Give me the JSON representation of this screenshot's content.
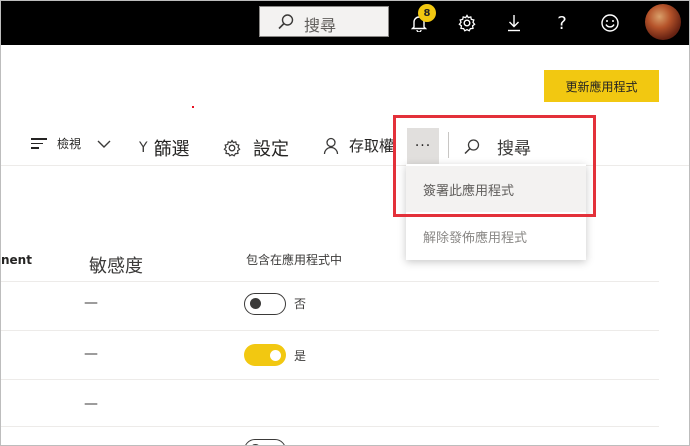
{
  "header": {
    "search_placeholder": "搜尋",
    "notification_count": "8",
    "icons": [
      "bell-icon",
      "gear-icon",
      "download-icon",
      "help-icon",
      "smiley-icon",
      "avatar"
    ]
  },
  "actions": {
    "update_app_label": "更新應用程式"
  },
  "toolbar": {
    "view_label": "檢視",
    "filter_label": "篩選",
    "settings_label": "設定",
    "access_label": "存取權",
    "more_label": "···",
    "search_label": "搜尋"
  },
  "more_menu": {
    "items": [
      {
        "label": "簽署此應用程式"
      },
      {
        "label": "解除發佈應用程式"
      }
    ]
  },
  "table": {
    "columns": [
      "nent",
      "敏感度",
      "包含在應用程式中"
    ],
    "rows": [
      {
        "sensitivity": "—",
        "included": false,
        "included_label": "否"
      },
      {
        "sensitivity": "—",
        "included": true,
        "included_label": "是"
      },
      {
        "sensitivity": "—",
        "included": null,
        "included_label": ""
      }
    ]
  },
  "colors": {
    "accent_yellow": "#f2c811",
    "highlight_red": "#e3313a",
    "topbar_black": "#000000"
  }
}
